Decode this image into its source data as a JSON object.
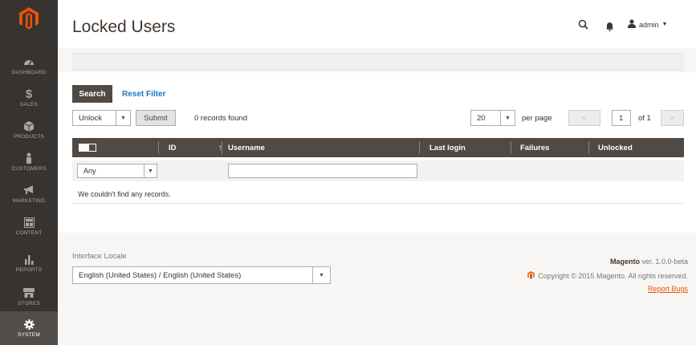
{
  "sidebar": {
    "items": [
      {
        "label": "DASHBOARD",
        "icon": "gauge-icon"
      },
      {
        "label": "SALES",
        "icon": "dollar-icon"
      },
      {
        "label": "PRODUCTS",
        "icon": "cube-icon"
      },
      {
        "label": "CUSTOMERS",
        "icon": "person-icon"
      },
      {
        "label": "MARKETING",
        "icon": "megaphone-icon"
      },
      {
        "label": "CONTENT",
        "icon": "layout-icon"
      },
      {
        "label": "REPORTS",
        "icon": "bar-chart-icon"
      },
      {
        "label": "STORES",
        "icon": "store-icon"
      },
      {
        "label": "SYSTEM",
        "icon": "gear-icon"
      }
    ]
  },
  "header": {
    "title": "Locked Users",
    "user": "admin"
  },
  "toolbar": {
    "search_label": "Search",
    "reset_label": "Reset Filter",
    "mass_action": "Unlock",
    "submit_label": "Submit",
    "records_found": "0 records found",
    "per_page_value": "20",
    "per_page_label": "per page",
    "prev_label": "<",
    "page_value": "1",
    "of_pages": "of 1",
    "next_label": ">"
  },
  "grid": {
    "columns": [
      "ID",
      "Username",
      "Last login",
      "Failures",
      "Unlocked"
    ],
    "sort_indicator": "↑",
    "filter_any": "Any",
    "empty_message": "We couldn't find any records."
  },
  "footer": {
    "locale_label": "Interface Locale",
    "locale_value": "English (United States) / English (United States)",
    "brand": "Magento",
    "version": "ver. 1.0.0-beta",
    "copyright": "Copyright © 2015 Magento. All rights reserved.",
    "report_bugs": "Report Bugs"
  },
  "colors": {
    "sidebar_bg": "#373330",
    "accent_orange": "#eb5202",
    "grid_header": "#514943",
    "link_blue": "#1979c3"
  }
}
